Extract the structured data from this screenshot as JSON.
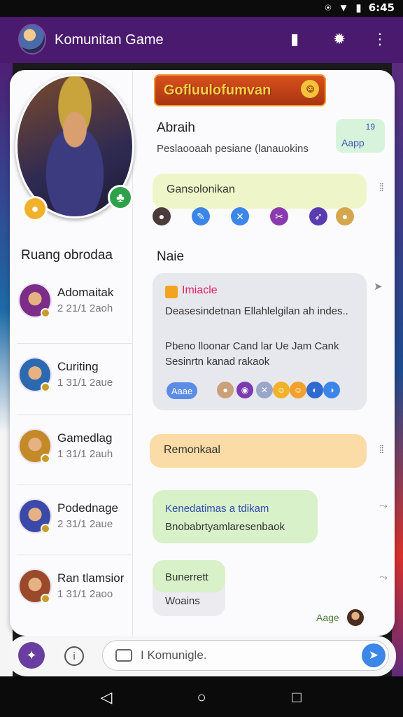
{
  "status_bar": {
    "time": "6:45"
  },
  "app_bar": {
    "title": "Komunitan Game"
  },
  "profile": {
    "banner": "Gofluulofumvan",
    "about_title": "Abraih",
    "about_desc": "Peslaooaah pesiane (lanauokins",
    "app_pill_count": "19",
    "app_pill_label": "Aapp"
  },
  "section_title": "Ruang obrodaa",
  "chats": [
    {
      "name": "Adomaitak",
      "time": "2 21/1 2aoh",
      "color": "#7b2d88"
    },
    {
      "name": "Curiting",
      "time": "1 31/1 2aue",
      "color": "#2b6ab0"
    },
    {
      "name": "Gamedlag",
      "time": "1 31/1 2auh",
      "color": "#c48a2a"
    },
    {
      "name": "Podednage",
      "time": "2 31/1 2aue",
      "color": "#3b4aa8"
    },
    {
      "name": "Ran tlamsior",
      "time": "1 31/1 2aoo",
      "color": "#9a4a2a"
    }
  ],
  "feed": {
    "green_bubble": "Gansolonikan",
    "heading": "Naie",
    "gray_bubble": {
      "title": "Imiacle",
      "line1": "Deasesindetnan Ellahlelgilan ah indes..",
      "line2": "Pbeno lloonar Cand lar Ue Jam Cank",
      "line3": "Sesinrtn kanad rakaok",
      "app_label": "Aaae"
    },
    "orange_bubble": "Remonkaal",
    "lgreen_bubble": {
      "line1": "Kenedatimas a tdikam",
      "line2": "Bnobabrtyamlaresenbaok"
    },
    "small_bubble": {
      "top": "Bunerrett",
      "bottom": "Woains"
    },
    "foot_label": "Aage"
  },
  "input": {
    "placeholder": "I Komunigle."
  },
  "colors": {
    "app_bar": "#4a1a6e",
    "accent": "#3b86e6"
  }
}
